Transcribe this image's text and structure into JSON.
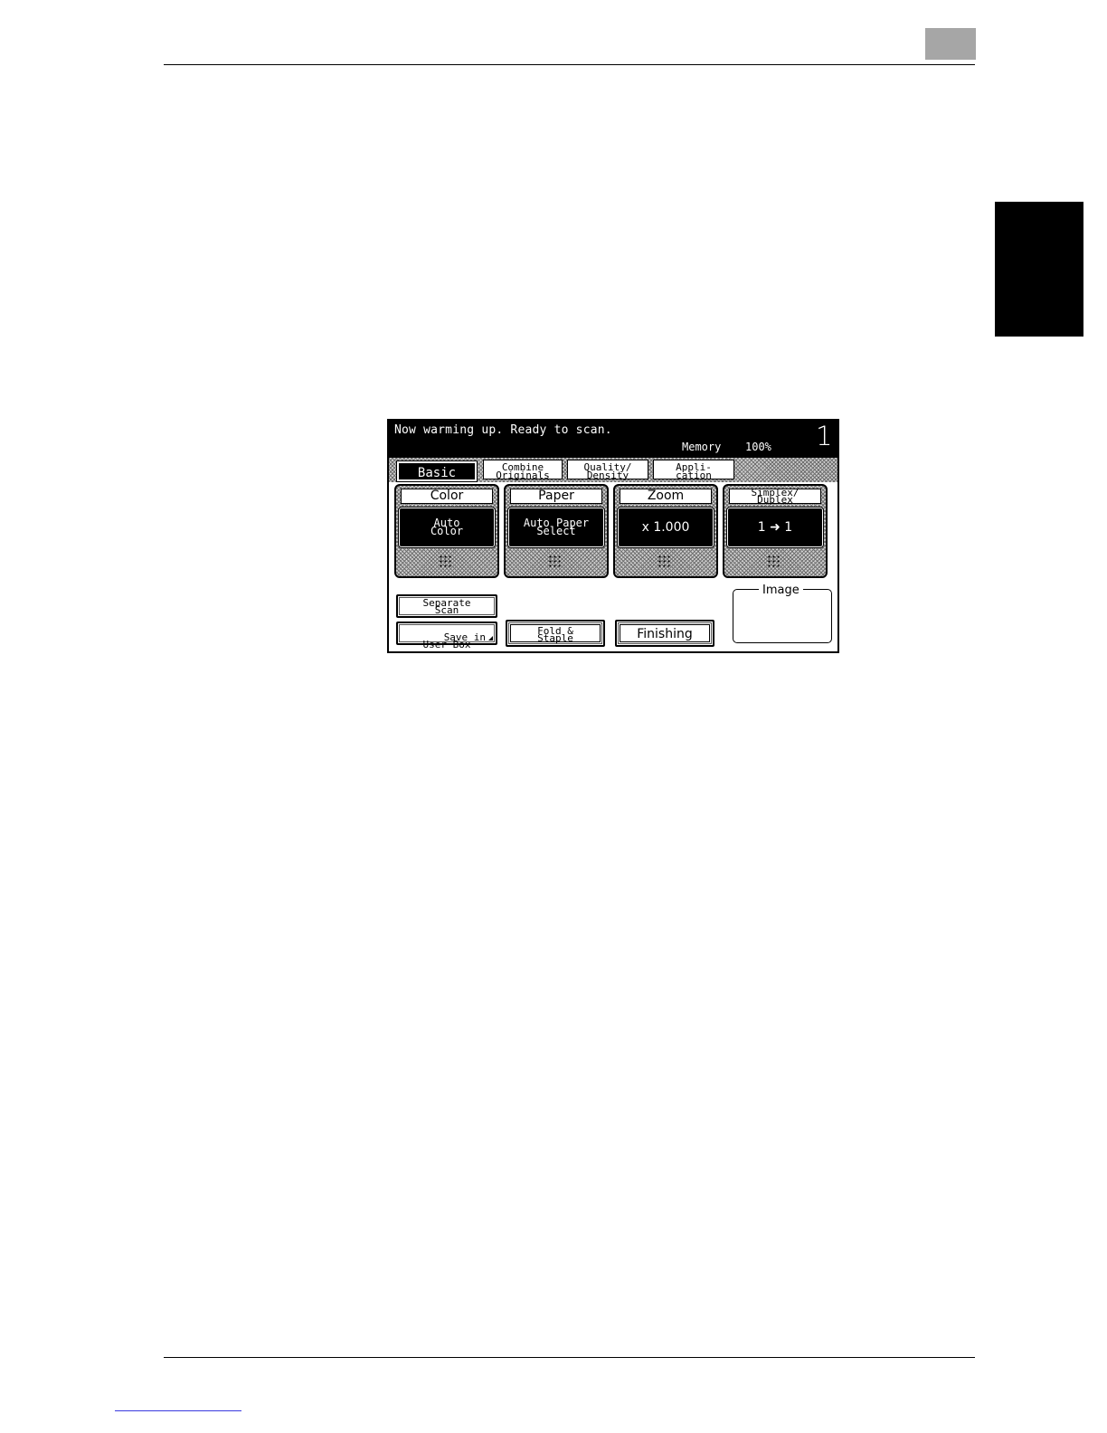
{
  "status": {
    "message": "Now warming up. Ready to scan.",
    "memory_label": "Memory",
    "memory_value": "100%",
    "copy_count": "1"
  },
  "tabs": [
    {
      "label": "Basic",
      "active": true
    },
    {
      "label": "Combine\nOriginals",
      "active": false
    },
    {
      "label": "Quality/\nDensity",
      "active": false
    },
    {
      "label": "Appli-\ncation",
      "active": false
    }
  ],
  "groups": {
    "color": {
      "label": "Color",
      "value": "Auto\nColor"
    },
    "paper": {
      "label": "Paper",
      "value": "Auto Paper\nSelect"
    },
    "zoom": {
      "label": "Zoom",
      "value": "x 1.000"
    },
    "simplex": {
      "label": "Simplex/\nDuplex",
      "value": "1 ➜ 1"
    }
  },
  "buttons": {
    "separate_scan": "Separate\nScan",
    "save_in_user_box": "Save in\nUser Box",
    "fold_staple": "Fold &\nStaple",
    "finishing": "Finishing"
  },
  "image_panel": {
    "label": "Image"
  },
  "colors": {
    "badge": "#a6a6a6",
    "chapter_tab": "#000000",
    "footer_link": "#3a3adf"
  }
}
